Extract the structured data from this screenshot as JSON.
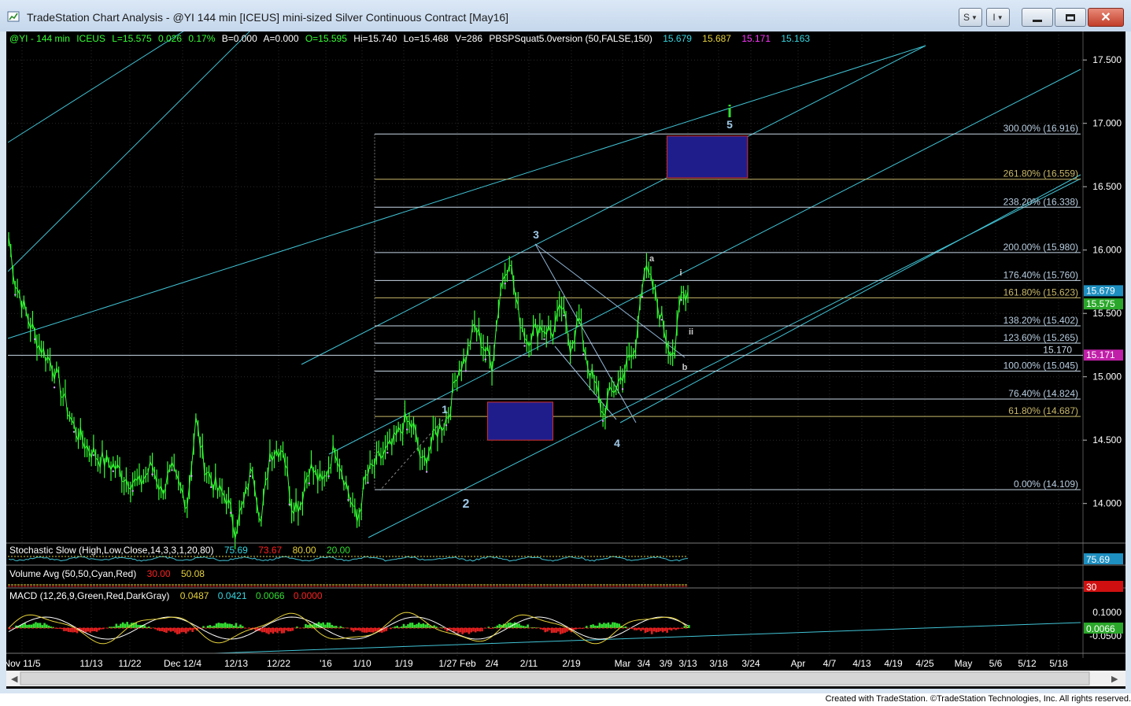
{
  "window": {
    "title": "TradeStation Chart Analysis - @YI 144 min [ICEUS] mini-sized Silver Continuous Contract [May16]",
    "buttons": [
      "S",
      "I"
    ]
  },
  "colors": {
    "background": "#000000",
    "price": "#33ff33",
    "channel": "#41c4d6",
    "fib_line": "#c8d8e6",
    "fib_gold": "#c8b86a",
    "target_box": "#1f1d8c",
    "target_border": "#d33030",
    "wave_label": "#9ec8e6",
    "green_label": "#33dd33",
    "cyan_text": "#35d7e0",
    "yellow_text": "#e6d23a",
    "magenta": "#ff33ff",
    "red": "#ff2020"
  },
  "chart_data": {
    "type": "line",
    "symbol_line": {
      "symbol": "@YI - 144 min",
      "exchange": "ICEUS",
      "L": "L=15.575",
      "chg": "0.026",
      "pct": "0.17%",
      "B": "B=0.000",
      "A": "A=0.000",
      "O": "O=15.595",
      "Hi": "Hi=15.740",
      "Lo": "Lo=15.468",
      "V": "V=286",
      "indicator": "PBSPSquat5.0version (50,FALSE,150)",
      "v1": "15.679",
      "v2": "15.687",
      "v3": "15.171",
      "v4": "15.163"
    },
    "ylim": [
      13.7,
      17.7
    ],
    "y_ticks": [
      "17.500",
      "17.000",
      "16.500",
      "16.000",
      "15.500",
      "15.000",
      "14.500",
      "14.000"
    ],
    "y_tick_values": [
      17.5,
      17.0,
      16.5,
      16.0,
      15.5,
      15.0,
      14.5,
      14.0
    ],
    "x_labels": [
      "Nov 11/5",
      "11/13",
      "11/22",
      "Dec 12/4",
      "12/13",
      "12/22",
      "'16",
      "1/10",
      "1/19",
      "1/27 Feb",
      "2/4",
      "2/11",
      "2/19",
      "Mar",
      "3/4",
      "3/9",
      "3/13",
      "3/18",
      "3/24",
      "Apr",
      "4/7",
      "4/13",
      "4/19",
      "4/25",
      "May",
      "5/6",
      "5/12",
      "5/18"
    ],
    "price_series": {
      "name": "@YI",
      "anchors": [
        [
          0,
          16.1
        ],
        [
          3,
          15.75
        ],
        [
          8,
          15.5
        ],
        [
          14,
          15.25
        ],
        [
          20,
          15.1
        ],
        [
          25,
          14.85
        ],
        [
          30,
          14.6
        ],
        [
          36,
          14.45
        ],
        [
          42,
          14.35
        ],
        [
          48,
          14.3
        ],
        [
          54,
          14.2
        ],
        [
          60,
          14.15
        ],
        [
          66,
          14.3
        ],
        [
          70,
          14.1
        ],
        [
          75,
          14.25
        ],
        [
          82,
          14.0
        ],
        [
          86,
          14.65
        ],
        [
          90,
          14.3
        ],
        [
          96,
          14.1
        ],
        [
          100,
          14.05
        ],
        [
          104,
          13.8
        ],
        [
          108,
          14.0
        ],
        [
          112,
          14.3
        ],
        [
          116,
          13.85
        ],
        [
          120,
          14.4
        ],
        [
          126,
          14.45
        ],
        [
          130,
          14.0
        ],
        [
          134,
          14.0
        ],
        [
          138,
          14.3
        ],
        [
          144,
          14.15
        ],
        [
          150,
          14.45
        ],
        [
          156,
          14.1
        ],
        [
          160,
          13.85
        ],
        [
          164,
          14.2
        ],
        [
          170,
          14.35
        ],
        [
          176,
          14.45
        ],
        [
          182,
          14.65
        ],
        [
          186,
          14.6
        ],
        [
          190,
          14.3
        ],
        [
          196,
          14.55
        ],
        [
          202,
          14.7
        ],
        [
          206,
          15.05
        ],
        [
          210,
          15.15
        ],
        [
          214,
          15.4
        ],
        [
          218,
          15.25
        ],
        [
          222,
          15.1
        ],
        [
          226,
          15.7
        ],
        [
          230,
          15.95
        ],
        [
          234,
          15.5
        ],
        [
          238,
          15.3
        ],
        [
          244,
          15.4
        ],
        [
          250,
          15.35
        ],
        [
          254,
          15.55
        ],
        [
          258,
          15.25
        ],
        [
          262,
          15.45
        ],
        [
          266,
          15.1
        ],
        [
          270,
          14.9
        ],
        [
          273,
          14.7
        ],
        [
          276,
          14.85
        ],
        [
          280,
          14.95
        ],
        [
          284,
          15.1
        ],
        [
          288,
          15.2
        ],
        [
          290,
          15.65
        ],
        [
          292,
          15.85
        ],
        [
          296,
          15.7
        ],
        [
          300,
          15.45
        ],
        [
          303,
          15.25
        ],
        [
          306,
          15.2
        ],
        [
          309,
          15.65
        ],
        [
          312,
          15.68
        ]
      ],
      "n": 313
    },
    "fib_levels": [
      {
        "label": "300.00% (16.916)",
        "value": 16.916
      },
      {
        "label": "261.80% (16.559)",
        "value": 16.559
      },
      {
        "label": "238.20% (16.338)",
        "value": 16.338
      },
      {
        "label": "200.00% (15.980)",
        "value": 15.98
      },
      {
        "label": "176.40% (15.760)",
        "value": 15.76
      },
      {
        "label": "161.80% (15.623)",
        "value": 15.623
      },
      {
        "label": "138.20% (15.402)",
        "value": 15.402
      },
      {
        "label": "123.60% (15.265)",
        "value": 15.265
      },
      {
        "label": "100.00% (15.045)",
        "value": 15.045
      },
      {
        "label": "76.40% (14.824)",
        "value": 14.824
      },
      {
        "label": "61.80% (14.687)",
        "value": 14.687
      },
      {
        "label": "0.00% (14.109)",
        "value": 14.109
      }
    ],
    "h_line": {
      "label": "15.170",
      "value": 15.17
    },
    "price_tags": [
      {
        "label": "15.679",
        "value": 15.679
      },
      {
        "label": "15.575",
        "value": 15.575
      },
      {
        "label": "15.171",
        "value": 15.171
      }
    ],
    "wave_labels": [
      "1",
      "2",
      "3",
      "4",
      "5",
      "a",
      "b",
      "i",
      "ii",
      "i"
    ],
    "target_boxes": [
      {
        "name": "wave-5-target",
        "x0": 250,
        "x1": 287,
        "y0": 16.57,
        "y1": 16.9
      },
      {
        "name": "wave-4-target",
        "x0": 220,
        "x1": 250,
        "y0": 14.5,
        "y1": 14.8
      }
    ],
    "stochastic": {
      "label": "Stochastic Slow (High,Low,Close,14,3,3,1,20,80)",
      "k": "75.69",
      "d": "73.67",
      "ob": "80.00",
      "os": "20.00",
      "tag": "75.69"
    },
    "volume": {
      "label": "Volume Avg (50,50,Cyan,Red)",
      "v1": "30.00",
      "v2": "50.08",
      "tag": "30"
    },
    "macd": {
      "label": "MACD (12,26,9,Green,Red,DarkGray)",
      "v1": "0.0487",
      "v2": "0.0421",
      "v3": "0.0066",
      "v4": "0.0000",
      "ticks": [
        "0.1000",
        "-0.0500"
      ],
      "tag": "0.0066"
    }
  },
  "footer": {
    "credit": "Created with TradeStation. ©TradeStation Technologies, Inc. All rights reserved."
  }
}
